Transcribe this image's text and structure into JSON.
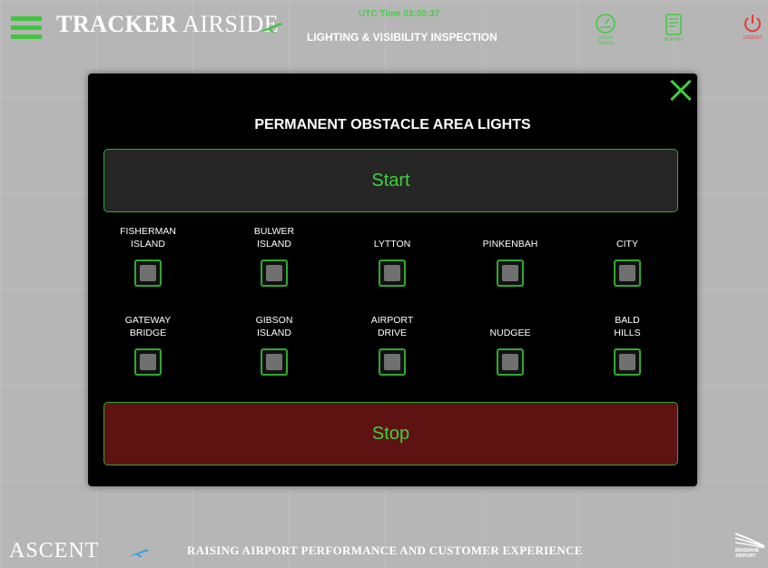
{
  "header": {
    "brand_a": "TRACKER",
    "brand_b": "AIRSIDE",
    "utc": "UTC Time 03:00:37",
    "title": "LIGHTING & VISIBILITY INSPECTION",
    "icons": [
      {
        "name": "gauge-icon",
        "label": "SPEED GAUGE"
      },
      {
        "name": "document-icon",
        "label": "REPORT"
      },
      {
        "name": "power-icon",
        "label": "LOGOUT"
      }
    ]
  },
  "modal": {
    "title": "PERMANENT OBSTACLE AREA LIGHTS",
    "start_label": "Start",
    "stop_label": "Stop",
    "locations": [
      {
        "line1": "FISHERMAN",
        "line2": "ISLAND",
        "checked": false
      },
      {
        "line1": "BULWER",
        "line2": "ISLAND",
        "checked": false
      },
      {
        "line1": "",
        "line2": "LYTTON",
        "checked": false
      },
      {
        "line1": "",
        "line2": "PINKENBAH",
        "checked": false
      },
      {
        "line1": "",
        "line2": "CITY",
        "checked": false
      },
      {
        "line1": "GATEWAY",
        "line2": "BRIDGE",
        "checked": false
      },
      {
        "line1": "GIBSON",
        "line2": "ISLAND",
        "checked": false
      },
      {
        "line1": "AIRPORT",
        "line2": "DRIVE",
        "checked": false
      },
      {
        "line1": "",
        "line2": "NUDGEE",
        "checked": false
      },
      {
        "line1": "BALD",
        "line2": "HILLS",
        "checked": false
      }
    ]
  },
  "footer": {
    "logo": "ASCENT",
    "tagline": "RAISING AIRPORT PERFORMANCE AND CUSTOMER EXPERIENCE",
    "partner_line1": "BRISBANE",
    "partner_line2": "AIRPORT"
  },
  "colors": {
    "accent_green": "#3ed23e",
    "stop_red": "#5e1212",
    "logout_red": "#e63a3a",
    "background": "#b6b6b6"
  }
}
